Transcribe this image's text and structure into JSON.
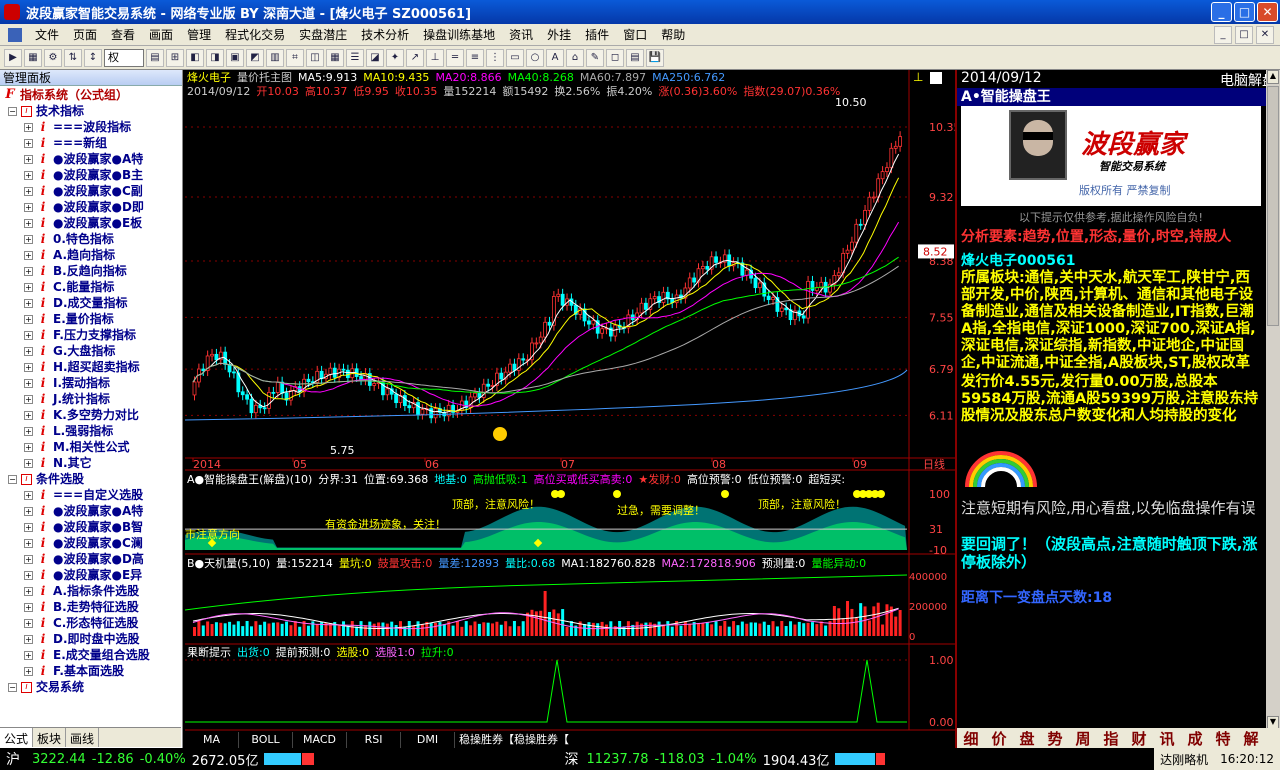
{
  "window": {
    "title": "波段赢家智能交易系统 - 网络专业版 BY 深南大道 - [烽火电子  SZ000561]"
  },
  "menu": [
    "文件",
    "页面",
    "查看",
    "画面",
    "管理",
    "程式化交易",
    "实盘潜庄",
    "技术分析",
    "操盘训练基地",
    "资讯",
    "外挂",
    "插件",
    "窗口",
    "帮助"
  ],
  "toolbar": {
    "combo": "权"
  },
  "left": {
    "title": "管理面板",
    "root": "指标系统（公式组）",
    "tree": [
      {
        "t": "g",
        "l": "技术指标"
      },
      {
        "t": "i",
        "l": "===波段指标"
      },
      {
        "t": "i",
        "l": "===新组"
      },
      {
        "t": "i",
        "l": "●波段赢家●A特"
      },
      {
        "t": "i",
        "l": "●波段赢家●B主"
      },
      {
        "t": "i",
        "l": "●波段赢家●C副"
      },
      {
        "t": "i",
        "l": "●波段赢家●D即"
      },
      {
        "t": "i",
        "l": "●波段赢家●E板"
      },
      {
        "t": "i",
        "l": "0.特色指标"
      },
      {
        "t": "i",
        "l": "A.趋向指标"
      },
      {
        "t": "i",
        "l": "B.反趋向指标"
      },
      {
        "t": "i",
        "l": "C.能量指标"
      },
      {
        "t": "i",
        "l": "D.成交量指标"
      },
      {
        "t": "i",
        "l": "E.量价指标"
      },
      {
        "t": "i",
        "l": "F.压力支撑指标"
      },
      {
        "t": "i",
        "l": "G.大盘指标"
      },
      {
        "t": "i",
        "l": "H.超买超卖指标"
      },
      {
        "t": "i",
        "l": "I.摆动指标"
      },
      {
        "t": "i",
        "l": "J.统计指标"
      },
      {
        "t": "i",
        "l": "K.多空势力对比"
      },
      {
        "t": "i",
        "l": "L.强弱指标"
      },
      {
        "t": "i",
        "l": "M.相关性公式"
      },
      {
        "t": "i",
        "l": "N.其它"
      },
      {
        "t": "g",
        "l": "条件选股"
      },
      {
        "t": "i",
        "l": "===自定义选股"
      },
      {
        "t": "i",
        "l": "●波段赢家●A特"
      },
      {
        "t": "i",
        "l": "●波段赢家●B智"
      },
      {
        "t": "i",
        "l": "●波段赢家●C澜"
      },
      {
        "t": "i",
        "l": "●波段赢家●D高"
      },
      {
        "t": "i",
        "l": "●波段赢家●E异"
      },
      {
        "t": "i",
        "l": "A.指标条件选股"
      },
      {
        "t": "i",
        "l": "B.走势特征选股"
      },
      {
        "t": "i",
        "l": "C.形态特征选股"
      },
      {
        "t": "i",
        "l": "D.即时盘中选股"
      },
      {
        "t": "i",
        "l": "E.成交量组合选股"
      },
      {
        "t": "i",
        "l": "F.基本面选股"
      },
      {
        "t": "g",
        "l": "交易系统"
      }
    ],
    "tabs": [
      "公式",
      "板块",
      "画线"
    ]
  },
  "chart": {
    "name": "烽火电子",
    "mainTitle": "量价托主图",
    "ma": [
      {
        "t": "MA5:9.913",
        "c": "#ffffff"
      },
      {
        "t": "MA10:9.435",
        "c": "#ffff00"
      },
      {
        "t": "MA20:8.866",
        "c": "#ff00ff"
      },
      {
        "t": "MA40:8.268",
        "c": "#00ff00"
      },
      {
        "t": "MA60:7.897",
        "c": "#aaaaaa"
      },
      {
        "t": "MA250:6.762",
        "c": "#4499ff"
      }
    ],
    "info": [
      {
        "t": "2014/09/12",
        "c": "#cccccc"
      },
      {
        "t": "开10.03",
        "c": "#ff3333"
      },
      {
        "t": "高10.37",
        "c": "#ff3333"
      },
      {
        "t": "低9.95",
        "c": "#ff3333"
      },
      {
        "t": "收10.35",
        "c": "#ff3333"
      },
      {
        "t": "量152214",
        "c": "#cccccc"
      },
      {
        "t": "额15492",
        "c": "#cccccc"
      },
      {
        "t": "换2.56%",
        "c": "#cccccc"
      },
      {
        "t": "振4.20%",
        "c": "#cccccc"
      },
      {
        "t": "涨(0.36)3.60%",
        "c": "#ff3333"
      },
      {
        "t": "指数(29.07)0.36%",
        "c": "#ff3333"
      }
    ],
    "priceTicks": [
      "10.35",
      "9.32",
      "8.38",
      "7.55",
      "6.79",
      "6.11"
    ],
    "hiLabel": "10.50",
    "loLabel": "5.75",
    "curLabel": "8.52",
    "months": [
      "2014",
      "05",
      "06",
      "07",
      "08",
      "09"
    ],
    "monthRight": "日线",
    "ind1": {
      "title": "A●智能操盘王(解盘)(10)",
      "items": [
        {
          "t": "分界:31",
          "c": "#ffffff"
        },
        {
          "t": "位置:69.368",
          "c": "#ffffff"
        },
        {
          "t": "地基:0",
          "c": "#00ffff"
        },
        {
          "t": "高抛低吸:1",
          "c": "#00ff00"
        },
        {
          "t": "高位买或低买高卖:0",
          "c": "#ff00ff"
        },
        {
          "t": "★发财:0",
          "c": "#ff3333"
        },
        {
          "t": "高位预警:0",
          "c": "#ffffff"
        },
        {
          "t": "低位预警:0",
          "c": "#ffffff"
        },
        {
          "t": "超短买:",
          "c": "#ffffff"
        }
      ],
      "ticks": [
        "100",
        "31",
        "-10"
      ],
      "notes": [
        "顶部，注意风险！",
        "过急，需要调整！",
        "顶部，注意风险！",
        "有资金进场迹象，关注！",
        "市注意方向"
      ]
    },
    "ind2": {
      "title": "B●天机量(5,10)",
      "items": [
        {
          "t": "量:152214",
          "c": "#ffffff"
        },
        {
          "t": "量坑:0",
          "c": "#ffff00"
        },
        {
          "t": "鼓量攻击:0",
          "c": "#ff3333"
        },
        {
          "t": "量差:12893",
          "c": "#4499ff"
        },
        {
          "t": "量比:0.68",
          "c": "#00ffff"
        },
        {
          "t": "MA1:182760.828",
          "c": "#ffffff"
        },
        {
          "t": "MA2:172818.906",
          "c": "#ff66ff"
        },
        {
          "t": "预测量:0",
          "c": "#ffffff"
        },
        {
          "t": "量能异动:0",
          "c": "#00ff00"
        }
      ],
      "ticks": [
        "400000",
        "200000",
        "0"
      ]
    },
    "ind3": {
      "title": "果断提示",
      "items": [
        {
          "t": "出货:0",
          "c": "#00ffff"
        },
        {
          "t": "提前预测:0",
          "c": "#ffffff"
        },
        {
          "t": "选股:0",
          "c": "#ffff00"
        },
        {
          "t": "选股1:0",
          "c": "#ff66ff"
        },
        {
          "t": "拉升:0",
          "c": "#00ff00"
        }
      ],
      "ticks": [
        "1.00",
        "0.00"
      ]
    },
    "bottomTabs": [
      "MA",
      "BOLL",
      "MACD",
      "RSI",
      "DMI",
      "稳操胜券【稳操胜券【"
    ]
  },
  "right": {
    "date": "2014/09/12",
    "head": "电脑解盘",
    "sub": "A•智能操盘王",
    "logoText": "波段赢家",
    "logoSub": "智能交易系统",
    "rights": "版权所有  严禁复制",
    "warn": "以下提示仅供参考,据此操作风险自负!",
    "elements": "分析要素:趋势,位置,形态,量价,时空,持股人",
    "stock": "烽火电子000561",
    "sector": "所属板块:通信,关中天水,航天军工,陕甘宁,西部开发,中价,陕西,计算机、通信和其他电子设备制造业,通信及相关设备制造业,IT指数,巨潮A指,全指电信,深证1000,深证700,深证A指,深证电信,深证综指,新指数,中证地企,中证国企,中证流通,中证全指,A股板块,ST,股权改革",
    "issue": "发行价4.55元,发行量0.00万股,总股本59584万股,流通A股59399万股,注意股东持股情况及股东总户数变化和人均持股的变化",
    "advice1": "注意短期有风险,用心看盘,以免临盘操作有误",
    "advice2a": "要回调了！",
    "advice2b": "（波段高点,注意随时触顶下跌,涨停板除外）",
    "days": "距离下一变盘点天数:18",
    "tabs": [
      "细",
      "价",
      "盘",
      "势",
      "周",
      "指",
      "财",
      "讯",
      "成",
      "特",
      "解"
    ]
  },
  "status": {
    "sh": "沪",
    "shv": "3222.44",
    "shc": "-12.86",
    "shp": "-0.40%",
    "sha": "2672.05亿",
    "sz": "深",
    "szv": "11237.78",
    "szc": "-118.03",
    "szp": "-1.04%",
    "sza": "1904.43亿",
    "net": "达刚略机",
    "time": "16:20:12"
  }
}
